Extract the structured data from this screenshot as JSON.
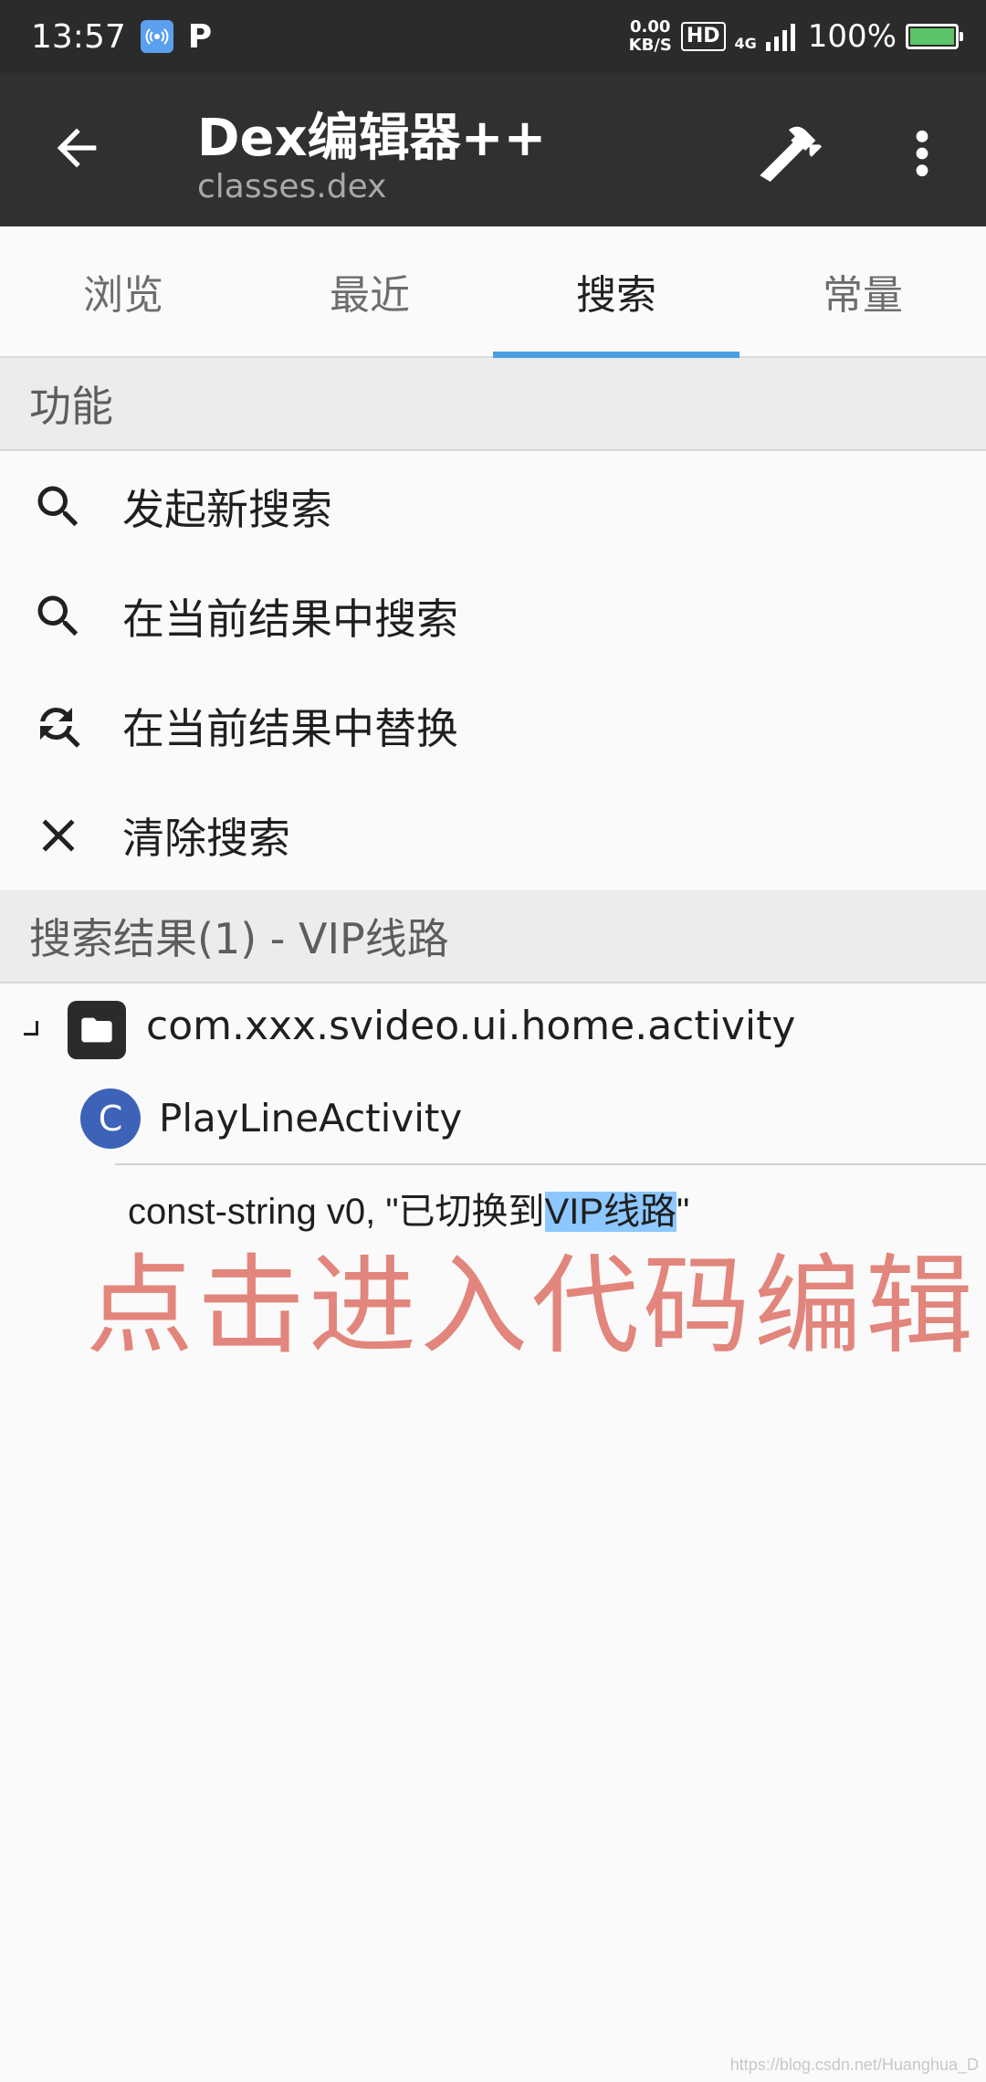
{
  "status_bar": {
    "time": "13:57",
    "p_badge": "P",
    "speed_value": "0.00",
    "speed_unit": "KB/S",
    "hd": "HD",
    "network": "4G",
    "battery_percent": "100%",
    "battery_level": 1.0,
    "icons": [
      "hotspot-icon",
      "signal-icon",
      "battery-icon"
    ],
    "colors": {
      "background": "#2b2b2b",
      "hotspot": "#5aa0ee",
      "battery": "#5cc468"
    }
  },
  "app_bar": {
    "title": "Dex编辑器++",
    "subtitle": "classes.dex",
    "icons": [
      "back-arrow-icon",
      "hammer-icon",
      "more-vert-icon"
    ],
    "background": "#303030"
  },
  "tabs": [
    {
      "label": "浏览",
      "active": false
    },
    {
      "label": "最近",
      "active": false
    },
    {
      "label": "搜索",
      "active": true
    },
    {
      "label": "常量",
      "active": false
    }
  ],
  "tab_indicator_color": "#4a9fe0",
  "functions": {
    "header": "功能",
    "items": [
      {
        "label": "发起新搜索",
        "icon": "search-icon"
      },
      {
        "label": "在当前结果中搜索",
        "icon": "search-icon"
      },
      {
        "label": "在当前结果中替换",
        "icon": "search-replace-icon"
      },
      {
        "label": "清除搜索",
        "icon": "close-icon"
      }
    ]
  },
  "results": {
    "header": "搜索结果(1) - VIP线路",
    "package": "com.xxx.svideo.ui.home.activity",
    "class_badge": "C",
    "class_name": "PlayLineActivity",
    "code_prefix": "const-string v0, \"已切换到",
    "code_highlight": "VIP线路",
    "code_suffix": "\"",
    "highlight_color": "#8cc7ff",
    "class_badge_color": "#3d63b8"
  },
  "annotation": "点击进入代码编辑",
  "annotation_color": "#e2857c",
  "watermark": "https://blog.csdn.net/Huanghua_D"
}
